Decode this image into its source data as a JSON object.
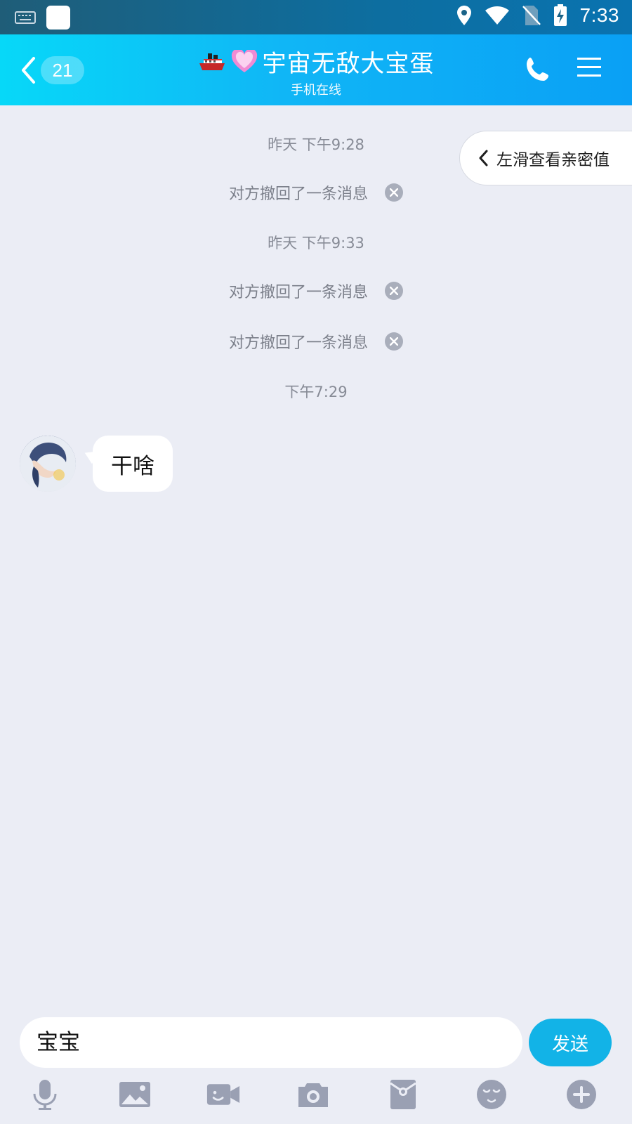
{
  "status_bar": {
    "time": "7:33"
  },
  "header": {
    "unread_count": "21",
    "title": "宇宙无敌大宝蛋",
    "subtitle": "手机在线"
  },
  "intimacy_hint": {
    "label": "左滑查看亲密值"
  },
  "chat": {
    "timestamps": [
      "昨天 下午9:28",
      "昨天 下午9:33",
      "下午7:29"
    ],
    "recalled_text": "对方撤回了一条消息",
    "messages": [
      {
        "sender": "other",
        "text": "干啥"
      }
    ]
  },
  "composer": {
    "input_value": "宝宝",
    "send_label": "发送"
  },
  "toolbar_icons": [
    "mic-icon",
    "image-icon",
    "video-icon",
    "camera-icon",
    "red-packet-icon",
    "emoji-icon",
    "plus-icon"
  ],
  "colors": {
    "accent": "#12b3e7",
    "header_start": "#07d8f8",
    "header_end": "#0aa0f5",
    "background": "#ebedf5"
  }
}
